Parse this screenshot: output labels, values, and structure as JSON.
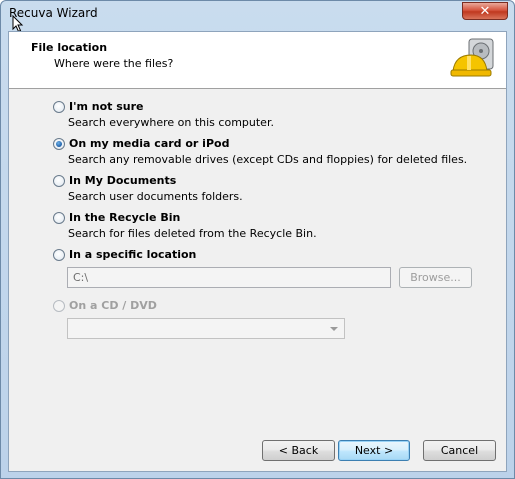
{
  "window": {
    "title": "Recuva Wizard",
    "close_glyph": "✕"
  },
  "header": {
    "title": "File location",
    "subtitle": "Where were the files?",
    "icon": "hard-drive-hardhat-icon"
  },
  "options": [
    {
      "label": "I'm not sure",
      "description": "Search everywhere on this computer.",
      "checked": false,
      "disabled": false
    },
    {
      "label": "On my media card or iPod",
      "description": "Search any removable drives (except CDs and floppies) for deleted files.",
      "checked": true,
      "disabled": false
    },
    {
      "label": "In My Documents",
      "description": "Search user documents folders.",
      "checked": false,
      "disabled": false
    },
    {
      "label": "In the Recycle Bin",
      "description": "Search for files deleted from the Recycle Bin.",
      "checked": false,
      "disabled": false
    },
    {
      "label": "In a specific location",
      "description": "",
      "checked": false,
      "disabled": false
    },
    {
      "label": "On a CD / DVD",
      "description": "",
      "checked": false,
      "disabled": true
    }
  ],
  "location": {
    "path_value": "C:\\",
    "browse_label": "Browse..."
  },
  "cd_dvd": {
    "selected_value": ""
  },
  "footer": {
    "back_label": "< Back",
    "next_label": "Next >",
    "cancel_label": "Cancel"
  },
  "colors": {
    "frame": "#bcd2ea",
    "client": "#f0f0f0",
    "close": "#c0381f",
    "default_button": "#3c7fb1"
  }
}
